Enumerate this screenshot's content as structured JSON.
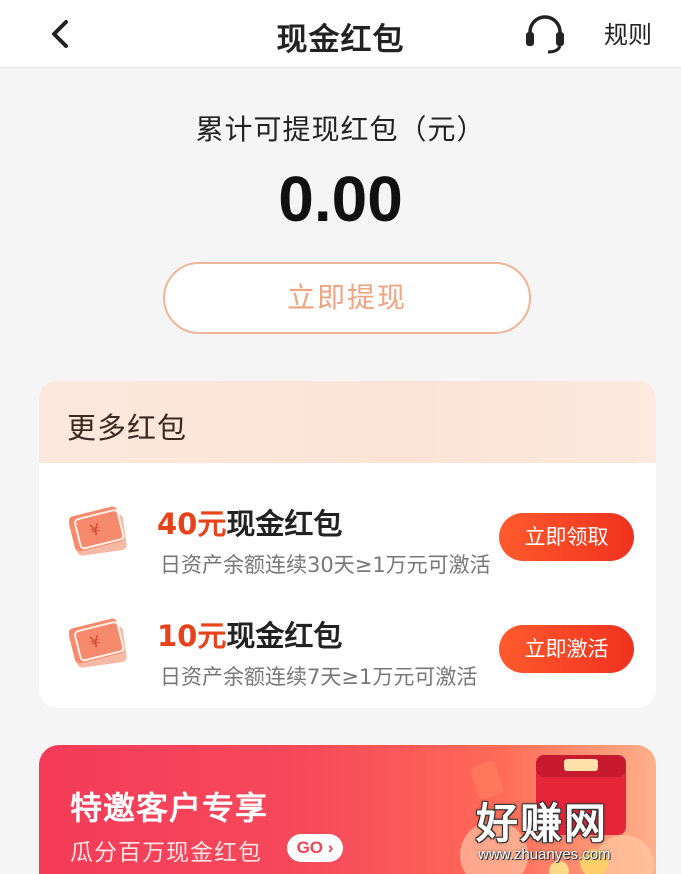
{
  "nav": {
    "title": "现金红包",
    "rules_label": "规则"
  },
  "summary": {
    "label": "累计可提现红包（元）",
    "amount": "0.00",
    "withdraw_label": "立即提现"
  },
  "more": {
    "title": "更多红包",
    "items": [
      {
        "amount": "40元",
        "name": "现金红包",
        "desc": "日资产余额连续30天≥1万元可激活",
        "button": "立即领取"
      },
      {
        "amount": "10元",
        "name": "现金红包",
        "desc": "日资产余额连续7天≥1万元可激活",
        "button": "立即激活"
      }
    ]
  },
  "promo": {
    "title": "特邀客户专享",
    "subtitle": "瓜分百万现金红包",
    "go_label": "GO ›"
  },
  "watermark": {
    "text": "好赚网",
    "url": "www.zhuanyes.com"
  },
  "colors": {
    "accent_red": "#e8421a",
    "button_gradient_start": "#ff5a2c",
    "button_gradient_end": "#f0321f",
    "withdraw_border": "#f1b49a"
  }
}
